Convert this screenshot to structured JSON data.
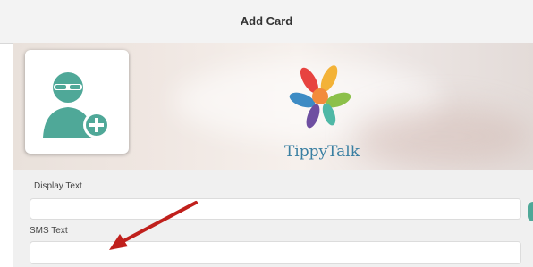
{
  "nav": {
    "title": "Add Card"
  },
  "logo": {
    "text": "TippyTalk"
  },
  "fields": {
    "display_text_label": "Display Text",
    "display_text_value": "",
    "sms_text_label": "SMS Text",
    "sms_text_value": ""
  },
  "icons": {
    "avatar": "add-user-icon",
    "logo": "hands-logo-icon"
  },
  "colors": {
    "accent": "#4fa898",
    "logo_text": "#3a7fa2",
    "annotation_arrow": "#c0201c"
  }
}
